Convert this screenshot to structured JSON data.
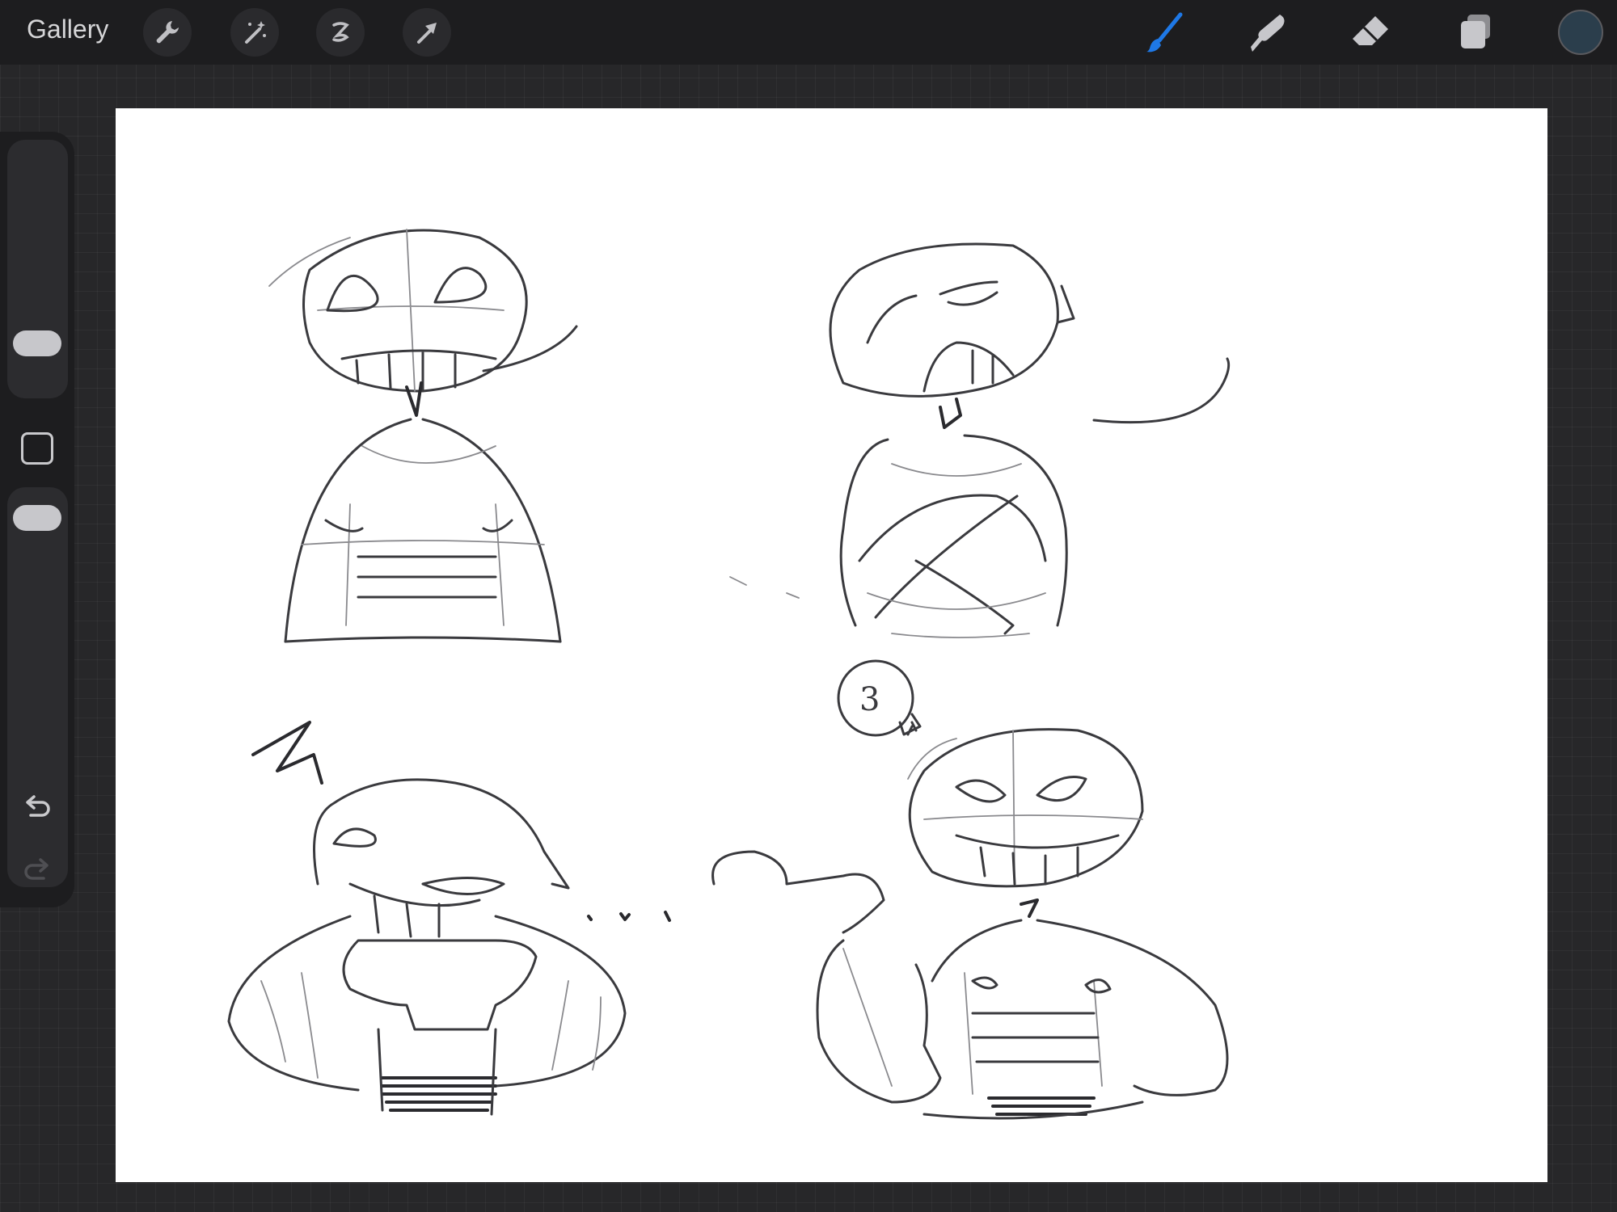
{
  "topbar": {
    "gallery_label": "Gallery",
    "left_tools": [
      "wrench-icon",
      "magic-wand-icon",
      "selection-icon",
      "transform-arrow-icon"
    ],
    "right_tools": [
      "brush-icon",
      "smudge-icon",
      "eraser-icon",
      "layers-icon"
    ],
    "active_tool": "brush-icon",
    "current_color": "#2b3e4c",
    "accent_color": "#1e78e6"
  },
  "sidebar": {
    "controls": [
      "brush-size-slider",
      "modify-button",
      "opacity-slider",
      "undo-icon",
      "redo-icon"
    ]
  },
  "canvas": {
    "background": "#ffffff",
    "content": "pencil-sketch",
    "thought_bubble_text": "3"
  }
}
